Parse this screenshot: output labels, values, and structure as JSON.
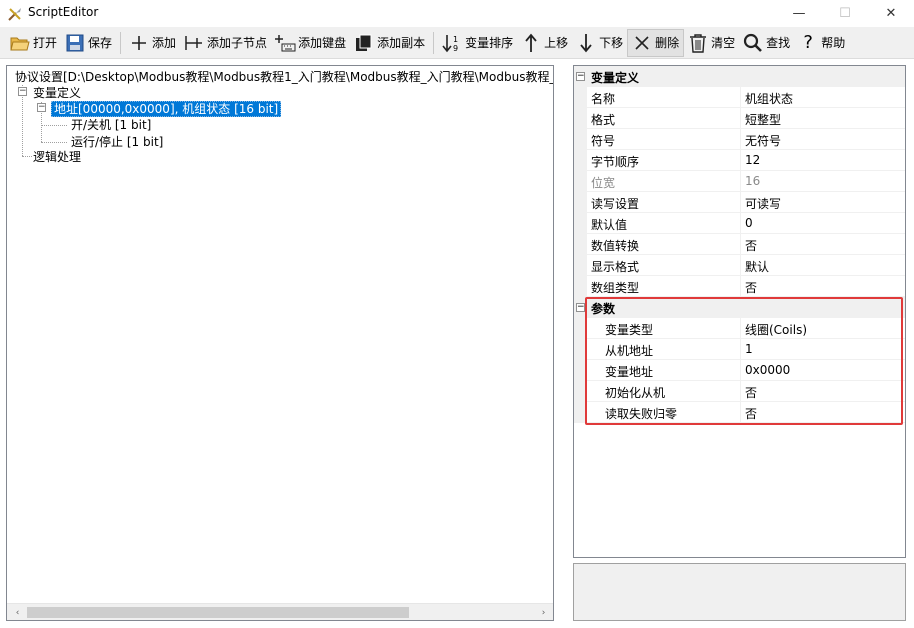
{
  "window": {
    "title": "ScriptEditor",
    "minimize": "—",
    "maximize": "☐",
    "close": "✕"
  },
  "toolbar": {
    "open": "打开",
    "save": "保存",
    "add": "添加",
    "add_child": "添加子节点",
    "add_keyboard": "添加键盘",
    "add_copy": "添加副本",
    "sort_vars": "变量排序",
    "move_up": "上移",
    "move_down": "下移",
    "delete": "删除",
    "clear": "清空",
    "find": "查找",
    "help": "帮助"
  },
  "tree": {
    "root": "协议设置[D:\\Desktop\\Modbus教程\\Modbus教程1_入门教程\\Modbus教程_入门教程\\Modbus教程_入",
    "var_def": "变量定义",
    "selected_node": "地址[00000,0x0000], 机组状态 [16 bit]",
    "child1": "开/关机 [1 bit]",
    "child2": "运行/停止 [1 bit]",
    "logic": "逻辑处理",
    "expander_minus": "−"
  },
  "props": {
    "cat1": "变量定义",
    "rows1": [
      {
        "name": "名称",
        "value": "机组状态"
      },
      {
        "name": "格式",
        "value": "短整型"
      },
      {
        "name": "符号",
        "value": "无符号"
      },
      {
        "name": "字节顺序",
        "value": "12"
      },
      {
        "name": "位宽",
        "value": "16"
      },
      {
        "name": "读写设置",
        "value": "可读写"
      },
      {
        "name": "默认值",
        "value": "0"
      },
      {
        "name": "数值转换",
        "value": "否"
      },
      {
        "name": "显示格式",
        "value": "默认"
      },
      {
        "name": "数组类型",
        "value": "否"
      }
    ],
    "cat2": "参数",
    "rows2": [
      {
        "name": "变量类型",
        "value": "线圈(Coils)"
      },
      {
        "name": "从机地址",
        "value": "1"
      },
      {
        "name": "变量地址",
        "value": "0x0000"
      },
      {
        "name": "初始化从机",
        "value": "否"
      },
      {
        "name": "读取失败归零",
        "value": "否"
      }
    ]
  },
  "scroll": {
    "left_arrow": "‹",
    "right_arrow": "›"
  },
  "colors": {
    "accent": "#0078d7",
    "highlight": "#e03a3a"
  }
}
